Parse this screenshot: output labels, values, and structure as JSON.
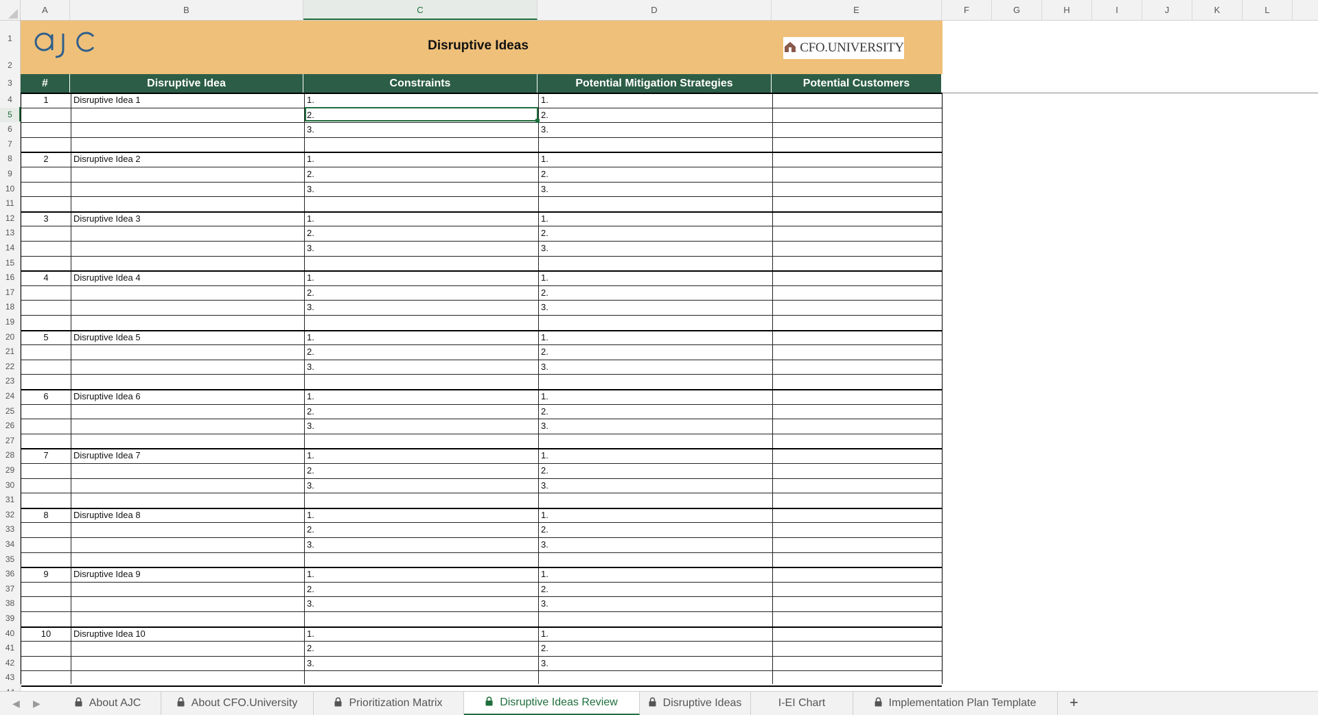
{
  "columns": [
    "A",
    "B",
    "C",
    "D",
    "E",
    "F",
    "G",
    "H",
    "I",
    "J",
    "K",
    "L"
  ],
  "active_column": "C",
  "active_row": 5,
  "title": "Disruptive Ideas",
  "logos": {
    "left": "AJC",
    "right": "CFO.UNIVERSITY"
  },
  "table_headers": [
    "#",
    "Disruptive Idea",
    "Constraints",
    "Potential Mitigation Strategies",
    "Potential Customers"
  ],
  "ideas": [
    {
      "num": "1",
      "name": "Disruptive Idea  1"
    },
    {
      "num": "2",
      "name": "Disruptive Idea 2"
    },
    {
      "num": "3",
      "name": "Disruptive Idea 3"
    },
    {
      "num": "4",
      "name": "Disruptive Idea 4"
    },
    {
      "num": "5",
      "name": "Disruptive Idea 5"
    },
    {
      "num": "6",
      "name": "Disruptive Idea 6"
    },
    {
      "num": "7",
      "name": "Disruptive Idea 7"
    },
    {
      "num": "8",
      "name": "Disruptive Idea 8"
    },
    {
      "num": "9",
      "name": "Disruptive Idea 9"
    },
    {
      "num": "10",
      "name": "Disruptive Idea 10"
    }
  ],
  "list_markers": [
    "1.",
    "2.",
    "3."
  ],
  "sheet_tabs": [
    {
      "label": "About AJC",
      "locked": true,
      "active": false
    },
    {
      "label": "About CFO.University",
      "locked": true,
      "active": false
    },
    {
      "label": "Prioritization Matrix",
      "locked": true,
      "active": false
    },
    {
      "label": "Disruptive Ideas Review",
      "locked": true,
      "active": true
    },
    {
      "label": "Disruptive Ideas",
      "locked": true,
      "active": false
    },
    {
      "label": "I-EI Chart",
      "locked": false,
      "active": false
    },
    {
      "label": "Implementation Plan Template",
      "locked": true,
      "active": false
    }
  ],
  "add_sheet_label": "+",
  "colors": {
    "accent": "#1e6e3c",
    "header_green": "#2c5d46",
    "banner": "#efc07a",
    "logo_blue": "#2f5f8c"
  }
}
